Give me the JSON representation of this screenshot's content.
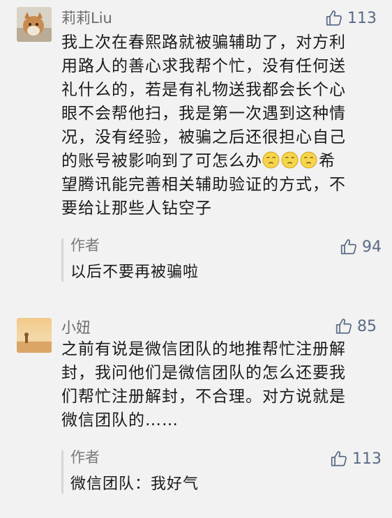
{
  "comments": [
    {
      "nickname": "莉莉Liu",
      "likes": "113",
      "text_lines": [
        "我上次在春熙路就被骗辅助了，对方利",
        "用路人的善心求我帮个忙，没有任何送",
        "礼什么的，若是有礼物送我都会长个心",
        "眼不会帮他扫，我是第一次遇到这种情",
        "况，没有经验，被骗之后还很担心自己",
        "的账号被影响到了可怎么办",
        "希",
        "望腾讯能完善相关辅助验证的方式，不",
        "要给让那些人钻空子"
      ],
      "reply": {
        "author": "作者",
        "likes": "94",
        "text": "以后不要再被骗啦"
      }
    },
    {
      "nickname": "小妞",
      "likes": "85",
      "text_lines": [
        "之前有说是微信团队的地推帮忙注册解",
        "封，我问他们是微信团队的怎么还要我",
        "们帮忙注册解封，不合理。对方说就是",
        "微信团队的……"
      ],
      "reply": {
        "author": "作者",
        "likes": "113",
        "text": "微信团队：我好气"
      }
    }
  ],
  "icons": {
    "like": "thumbs-up-icon",
    "emoji": "pensive-face-icon"
  },
  "colors": {
    "background": "#f2f2f2",
    "like_blue": "#5a6a85",
    "nickname_gray": "#6b6b6b",
    "reply_bar": "#d7d7d7"
  }
}
